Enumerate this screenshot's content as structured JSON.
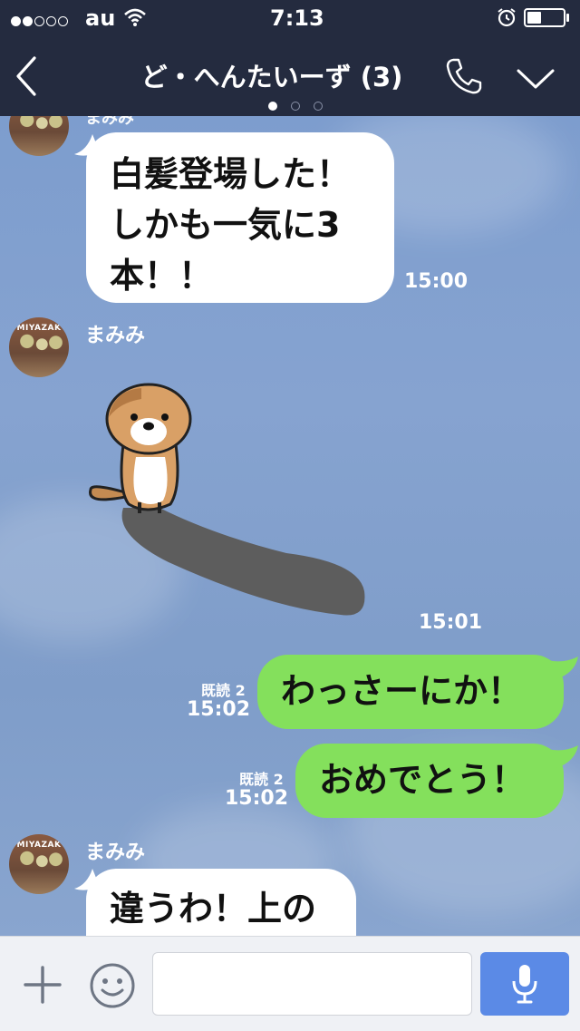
{
  "status_bar": {
    "carrier": "au",
    "time": "7:13",
    "signal_level": 2,
    "signal_total": 5,
    "battery_percent": 40
  },
  "header": {
    "title": "ど・へんたいーず (3)",
    "page_dots": 3,
    "active_page": 0
  },
  "messages": [
    {
      "type": "incoming",
      "sender": "まみみ",
      "text_lines": [
        "白髪登場した！",
        "しかも一気に3",
        "本！！"
      ],
      "time": "15:00"
    },
    {
      "type": "incoming_sticker",
      "sender": "まみみ",
      "sticker": "otter-sticker",
      "time": "15:01"
    },
    {
      "type": "outgoing",
      "read": "既読 2",
      "time": "15:02",
      "text": "わっさーにか！"
    },
    {
      "type": "outgoing",
      "read": "既読 2",
      "time": "15:02",
      "text": "おめでとう！"
    },
    {
      "type": "incoming",
      "sender": "まみみ",
      "text_lines": [
        "違うわ！上の"
      ]
    }
  ],
  "avatar_text": "MIYAZAK",
  "colors": {
    "header_bg": "#242b3f",
    "outgoing_bubble": "#84e05c",
    "incoming_bubble": "#ffffff",
    "send_button": "#5b8ae6"
  },
  "icons": [
    "back-icon",
    "phone-icon",
    "chevron-down-icon",
    "plus-icon",
    "emoji-icon",
    "mic-icon",
    "wifi-icon",
    "alarm-icon",
    "battery-icon"
  ]
}
